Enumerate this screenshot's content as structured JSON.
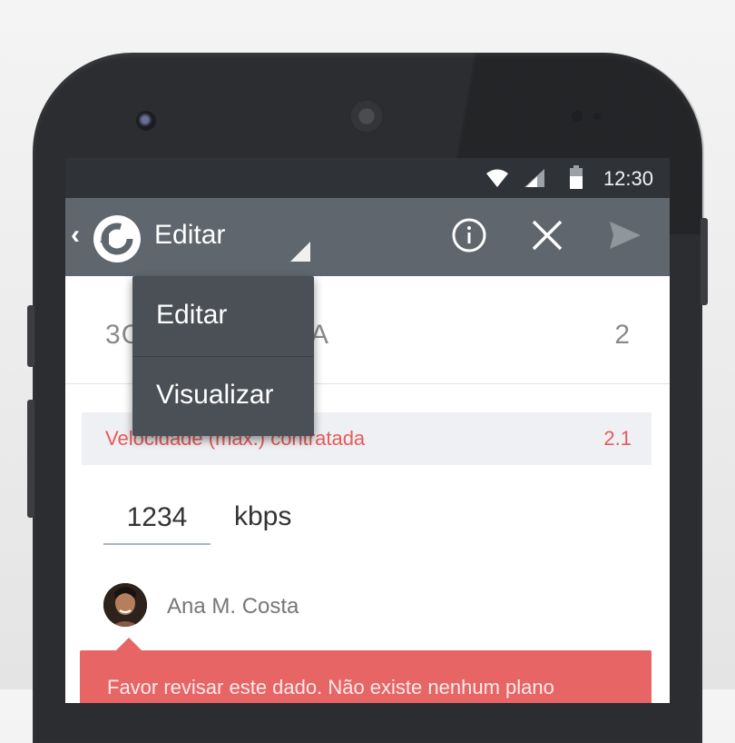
{
  "status_bar": {
    "time": "12:30",
    "icons": [
      "wifi-icon",
      "signal-icon",
      "battery-icon"
    ]
  },
  "app_bar": {
    "back_icon": "chevron-left-icon",
    "logo_icon": "refresh-logo-icon",
    "title": "Editar",
    "actions": [
      "info-icon",
      "close-icon",
      "send-icon"
    ]
  },
  "dropdown": {
    "items": [
      {
        "label": "Editar"
      },
      {
        "label": "Visualizar"
      }
    ]
  },
  "row": {
    "left": "3C",
    "left_tail": "A",
    "right": "2"
  },
  "error_row": {
    "label": "Velocidade (máx.) contratada",
    "value": "2.1"
  },
  "speed": {
    "value": "1234",
    "unit": "kbps"
  },
  "comment": {
    "user": "Ana M. Costa",
    "text": "Favor revisar este dado. Não existe nenhum plano"
  },
  "colors": {
    "appbar": "#5f666d",
    "statusbar": "#2f3338",
    "error": "#e85a5a",
    "comment_bg": "#e76565"
  }
}
